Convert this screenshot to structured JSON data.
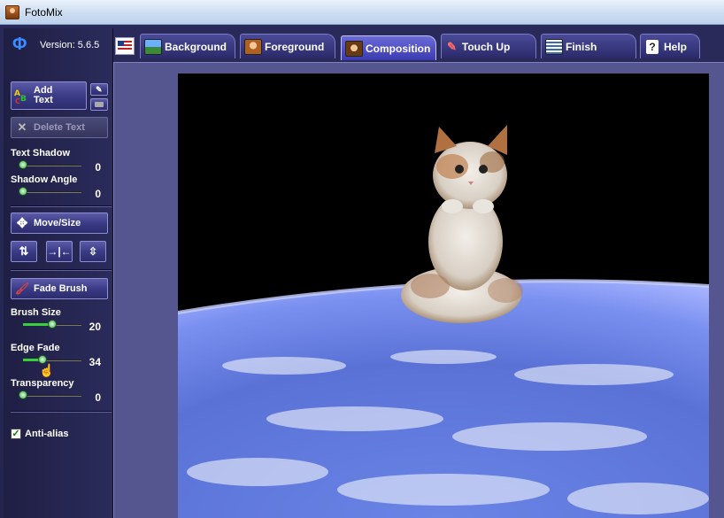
{
  "window": {
    "title": "FotoMix"
  },
  "app": {
    "version_label": "Version: 5.6.5"
  },
  "tabs": [
    {
      "label": "Background",
      "active": false
    },
    {
      "label": "Foreground",
      "active": false
    },
    {
      "label": "Composition",
      "active": true
    },
    {
      "label": "Touch Up",
      "active": false
    },
    {
      "label": "Finish",
      "active": false
    },
    {
      "label": "Help",
      "active": false
    }
  ],
  "panel": {
    "add_text_line1": "Add",
    "add_text_line2": "Text",
    "delete_text": "Delete Text",
    "text_shadow": {
      "label": "Text Shadow",
      "value": "0",
      "fraction": 0.0
    },
    "shadow_angle": {
      "label": "Shadow Angle",
      "value": "0",
      "fraction": 0.0
    },
    "move_size": "Move/Size",
    "fade_brush": "Fade Brush",
    "brush_size": {
      "label": "Brush Size",
      "value": "20",
      "fraction": 0.5
    },
    "edge_fade": {
      "label": "Edge Fade",
      "value": "34",
      "fraction": 0.34
    },
    "transparency": {
      "label": "Transparency",
      "value": "0",
      "fraction": 0.0
    },
    "anti_alias": {
      "label": "Anti-alias",
      "checked": true
    }
  },
  "colors": {
    "accent": "#3b3bb0",
    "slider_fill": "#39d139",
    "earth": "#5a7ad8",
    "space": "#000000"
  },
  "icons": [
    "app-icon",
    "fotomix-logo-icon",
    "flag-icon",
    "text-abc-icon",
    "pencil-icon",
    "eraser-icon",
    "delete-x-icon",
    "move-arrows-icon",
    "flip-vertical-icon",
    "flip-horizontal-icon",
    "center-icon",
    "brush-icon",
    "help-question-icon",
    "hand-cursor-icon"
  ]
}
